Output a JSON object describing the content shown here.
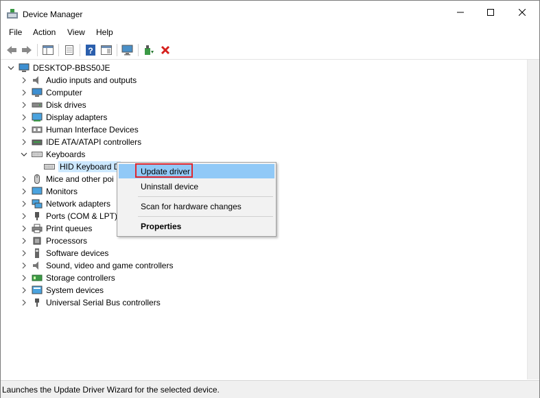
{
  "window": {
    "title": "Device Manager"
  },
  "menu": [
    {
      "label": "File"
    },
    {
      "label": "Action"
    },
    {
      "label": "View"
    },
    {
      "label": "Help"
    }
  ],
  "tree": {
    "root": "DESKTOP-BBS50JE",
    "items": [
      {
        "label": "Audio inputs and outputs",
        "icon": "speaker-icon"
      },
      {
        "label": "Computer",
        "icon": "computer-icon"
      },
      {
        "label": "Disk drives",
        "icon": "disk-drive-icon"
      },
      {
        "label": "Display adapters",
        "icon": "display-adapter-icon"
      },
      {
        "label": "Human Interface Devices",
        "icon": "hid-icon"
      },
      {
        "label": "IDE ATA/ATAPI controllers",
        "icon": "ide-controller-icon"
      },
      {
        "label": "Keyboards",
        "icon": "keyboard-icon",
        "expanded": true,
        "children": [
          {
            "label": "HID Keyboard D"
          }
        ]
      },
      {
        "label": "Mice and other poi",
        "icon": "mouse-icon"
      },
      {
        "label": "Monitors",
        "icon": "monitor-icon"
      },
      {
        "label": "Network adapters",
        "icon": "network-adapter-icon"
      },
      {
        "label": "Ports (COM & LPT)",
        "icon": "port-icon"
      },
      {
        "label": "Print queues",
        "icon": "printer-icon"
      },
      {
        "label": "Processors",
        "icon": "processor-icon"
      },
      {
        "label": "Software devices",
        "icon": "software-device-icon"
      },
      {
        "label": "Sound, video and game controllers",
        "icon": "sound-controller-icon"
      },
      {
        "label": "Storage controllers",
        "icon": "storage-controller-icon"
      },
      {
        "label": "System devices",
        "icon": "system-device-icon"
      },
      {
        "label": "Universal Serial Bus controllers",
        "icon": "usb-icon"
      }
    ]
  },
  "context_menu": {
    "update_driver": "Update driver",
    "uninstall_device": "Uninstall device",
    "scan_hardware": "Scan for hardware changes",
    "properties": "Properties"
  },
  "status": {
    "text": "Launches the Update Driver Wizard for the selected device."
  },
  "colors": {
    "accent_highlight": "#91c9f7",
    "annotation_red": "#e0262d",
    "selection": "#cce8ff"
  }
}
